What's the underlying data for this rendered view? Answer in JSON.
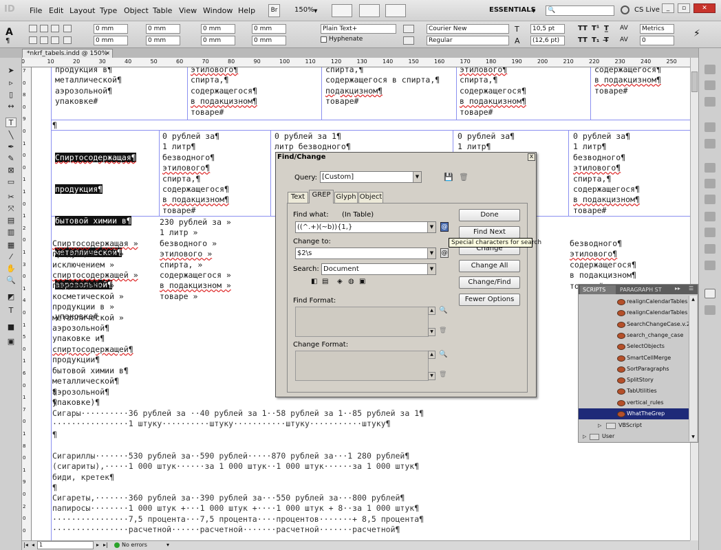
{
  "app": {
    "logo": "ID",
    "menu": [
      "File",
      "Edit",
      "Layout",
      "Type",
      "Object",
      "Table",
      "View",
      "Window",
      "Help"
    ],
    "br_label": "Br",
    "zoom": "150%",
    "workspace": "ESSENTIALS",
    "cs_live": "CS Live"
  },
  "control": {
    "fields_mm": [
      "0 mm",
      "0 mm",
      "0 mm",
      "0 mm",
      "0 mm",
      "0 mm",
      "0 mm",
      "0 mm"
    ],
    "paragraph_style": "Plain Text+",
    "hyphenate": "Hyphenate",
    "font_family": "Courier New",
    "font_style": "Regular",
    "size": "10,5 pt",
    "leading": "(12,6 pt)",
    "kerning": "Metrics",
    "tracking": "0",
    "tt": [
      "TT",
      "T¹",
      "T̲"
    ],
    "tt2": [
      "TT",
      "T₁",
      "T̶"
    ]
  },
  "document": {
    "tab": "*nkrf_tabels.indd @ 150%",
    "ruler": [
      "0",
      "10",
      "20",
      "30",
      "40",
      "50",
      "60",
      "70",
      "80",
      "90",
      "100",
      "110",
      "120",
      "130",
      "140",
      "150",
      "160",
      "170",
      "180",
      "190",
      "200",
      "210",
      "220",
      "230",
      "240",
      "250",
      "260"
    ],
    "vruler": [
      "7",
      "0",
      "8",
      "0",
      "9",
      "0",
      "1",
      "0",
      "0",
      "1",
      "1",
      "0",
      "1",
      "2",
      "0",
      "1",
      "3",
      "0",
      "1",
      "4",
      "0",
      "1",
      "5",
      "0",
      "1",
      "6",
      "0",
      "1",
      "7",
      "0",
      "1",
      "8",
      "0",
      "1",
      "9",
      "0",
      "2",
      "0",
      "0"
    ]
  },
  "text": {
    "r1": {
      "c1": [
        "продукция в¶",
        "металлической¶",
        "аэрозольной¶",
        "упаковке#"
      ],
      "c2": [
        "этилового¶",
        "спирта,¶",
        "содержащегося¶",
        "в подакцизном¶",
        "товаре#"
      ],
      "c3": [
        "спирта,¶",
        "содержащегося в спирта,¶",
        "подакцизном¶",
        "товаре#"
      ],
      "c4": [
        "этилового¶",
        "спирта,¶",
        "содержащегося¶",
        "в подакцизном¶",
        "товаре#"
      ],
      "c5": [
        "содержащегося¶",
        "в подакцизном¶",
        "товаре#"
      ]
    },
    "para1": "¶",
    "r2": {
      "c1hl": [
        "Спиртосодержащая¶",
        "продукция¶",
        "бытовой химии в¶",
        "металлической¶",
        "аэрозольной¶"
      ],
      "c1": "упаковке#",
      "c2": [
        "0 рублей за¶",
        "1 литр¶",
        "безводного¶",
        "этилового¶",
        "спирта,¶",
        "содержащегося¶",
        "в подакцизном¶",
        "товаре#"
      ],
      "c3": [
        "0 рублей за 1¶",
        "литр безводного¶"
      ],
      "c4": [
        "0 рублей за¶",
        "1 литр¶"
      ],
      "c5": [
        "0 рублей за¶",
        "1 литр¶",
        "безводного¶",
        "этилового¶",
        "спирта,¶",
        "содержащегося¶",
        "в подакцизном¶",
        "товаре#"
      ]
    },
    "r3": {
      "c1": [
        "Спиртосодержащая »",
        "продукция (за »",
        "исключением »",
        "спиртосодержащей »",
        "парфюмерно- »",
        "косметической »",
        "продукции в »",
        "металлической »",
        "аэрозольной¶",
        "упаковке и¶",
        "спиртосодержащей¶",
        "продукции¶",
        "бытовой химии в¶",
        "металлической¶",
        "аэрозольной¶",
        "упаковке)¶"
      ],
      "c2": [
        "230 рублей за »",
        "1 литр »",
        "безводного »",
        "этилового »",
        "спирта, »",
        "содержащегося »",
        "в подакцизном »",
        "товаре »"
      ],
      "c5": [
        "безводного¶",
        "этилового¶",
        "",
        "содержащегося¶",
        "в подакцизном¶",
        "товаре#"
      ]
    },
    "blank": [
      "¶",
      "¶"
    ],
    "cigars": [
      "Сигары··········36 рублей за ··40 рублей за 1··58 рублей за 1··85 рублей за 1¶",
      "················1 штуку··········штуку···········штуку···········штуку¶",
      "¶"
    ],
    "cigarillos": [
      "Сигариллы·······530 рублей за··590 рублей·····870 рублей за···1 280 рублей¶",
      "(сигариты),·····1 000 штук······за 1 000 штук··1 000 штук······за 1 000 штук¶",
      "биди, кретек¶",
      "¶"
    ],
    "cigarettes": [
      "Сигареты,·······360 рублей за··390 рублей за···550 рублей за···800 рублей¶",
      "папиросы········1 000 штук +···1 000 штук +····1 000 штук + 8··за 1 000 штук¶",
      "················7,5 процента···7,5 процента····процентов·······+ 8,5 процента¶",
      "················расчетной······расчетной·······расчетной·······расчетной¶"
    ]
  },
  "dialog": {
    "title": "Find/Change",
    "close": "x",
    "query_label": "Query:",
    "query_value": "[Custom]",
    "tabs": [
      "Text",
      "GREP",
      "Glyph",
      "Object"
    ],
    "find_what_label": "Find what:",
    "in_table": "(In Table)",
    "find_value": "((^.+)(~b)){1,}",
    "change_to_label": "Change to:",
    "change_value": "$2\\s",
    "search_label": "Search:",
    "search_value": "Document",
    "find_format_label": "Find Format:",
    "change_format_label": "Change Format:",
    "buttons": [
      "Done",
      "Find Next",
      "Change",
      "Change All",
      "Change/Find",
      "Fewer Options"
    ]
  },
  "tooltip": "Special characters for search",
  "status": {
    "page": "1",
    "errors": "No errors"
  },
  "scripts_panel": {
    "tabs": [
      "SCRIPTS",
      "PARAGRAPH ST"
    ],
    "items": [
      "realignCalendarTables",
      "realignCalendarTables",
      "SearchChangeCase.v.2",
      "search_change_case",
      "SelectObjects",
      "SmartCellMerge",
      "SortParagraphs",
      "SplitStory",
      "TabUtilities",
      "vertical_rules",
      "WhatTheGrep"
    ],
    "folders": [
      "VBScript",
      "User"
    ],
    "selected": "WhatTheGrep"
  }
}
